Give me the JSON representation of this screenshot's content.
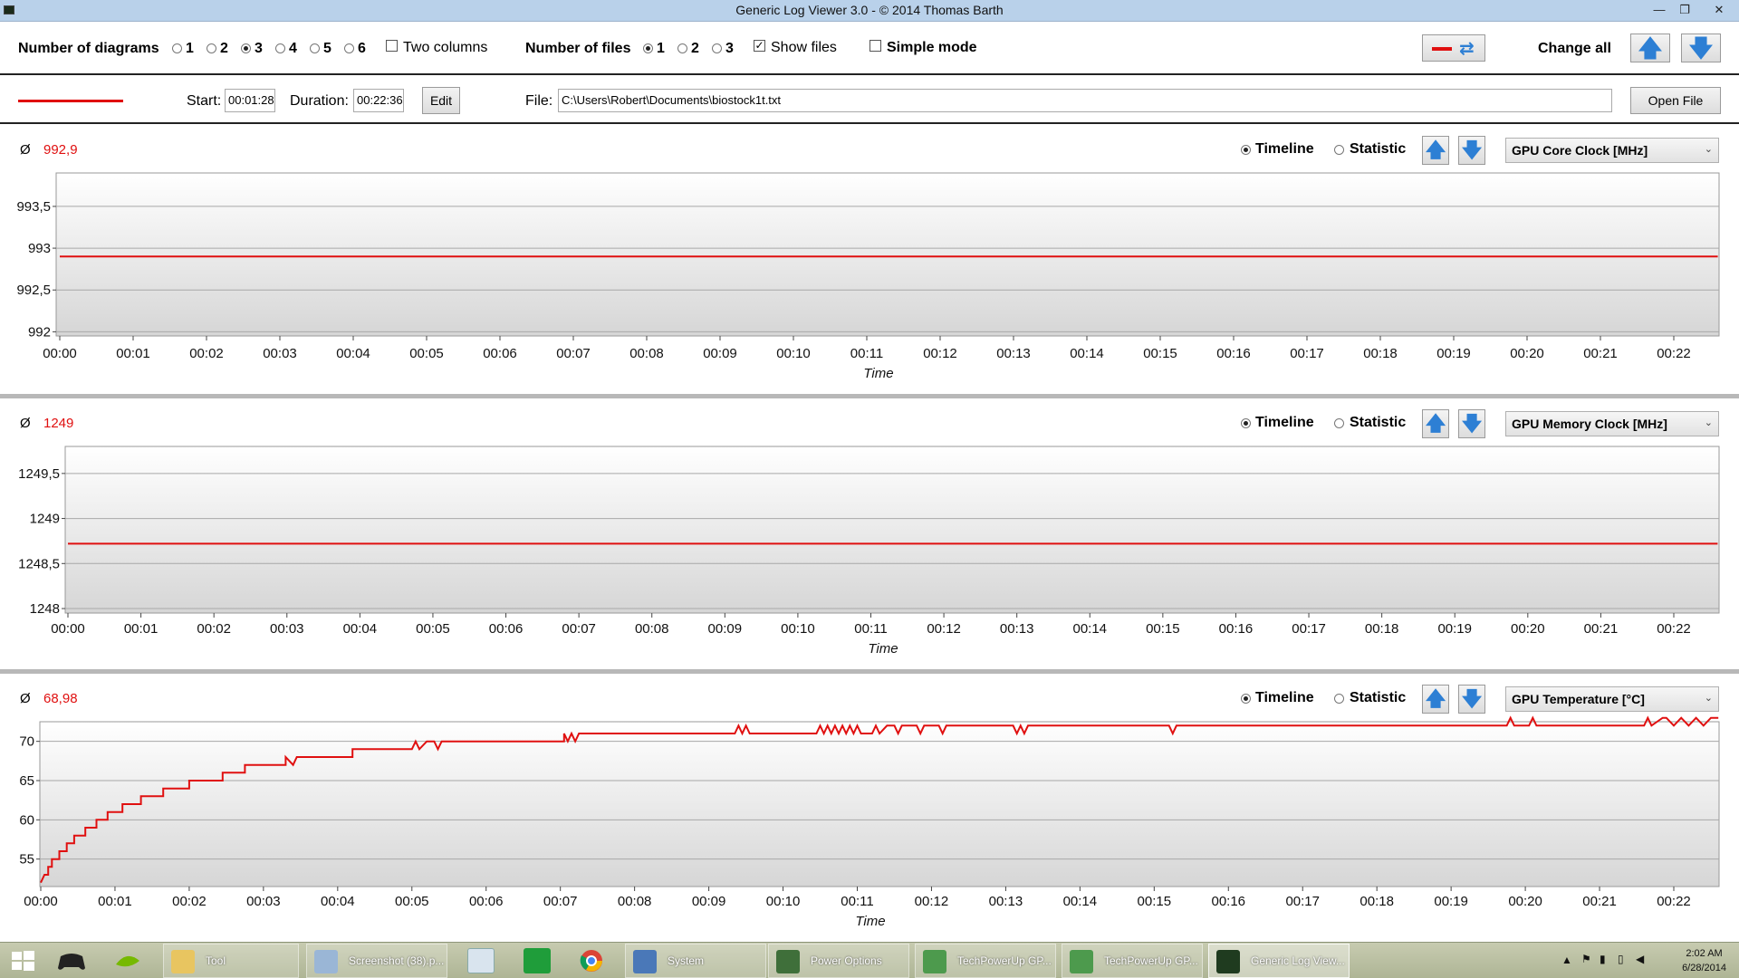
{
  "window": {
    "title": "Generic Log Viewer 3.0 - © 2014 Thomas Barth",
    "minimize": "—",
    "restore": "❐",
    "close": "✕"
  },
  "options": {
    "diagrams_label": "Number of diagrams",
    "diagram_choices": [
      "1",
      "2",
      "3",
      "4",
      "5",
      "6"
    ],
    "diagram_selected": "3",
    "two_columns_label": "Two columns",
    "two_columns_checked": false,
    "files_label": "Number of files",
    "file_choices": [
      "1",
      "2",
      "3"
    ],
    "file_selected": "1",
    "show_files_label": "Show files",
    "show_files_checked": true,
    "simple_mode_label": "Simple mode",
    "simple_mode_checked": false,
    "change_all_label": "Change all"
  },
  "file_bar": {
    "line_color": "#e01010",
    "start_label": "Start:",
    "start_value": "00:01:28",
    "duration_label": "Duration:",
    "duration_value": "00:22:36",
    "edit_label": "Edit",
    "file_label": "File:",
    "file_path": "C:\\Users\\Robert\\Documents\\biostock1t.txt",
    "open_file_label": "Open File"
  },
  "diagrams": [
    {
      "avg_symbol": "Ø",
      "avg_value": "992,9",
      "timeline_label": "Timeline",
      "statistic_label": "Statistic",
      "mode": "timeline",
      "sensor": "GPU Core Clock [MHz]"
    },
    {
      "avg_symbol": "Ø",
      "avg_value": "1249",
      "timeline_label": "Timeline",
      "statistic_label": "Statistic",
      "mode": "timeline",
      "sensor": "GPU Memory Clock [MHz]"
    },
    {
      "avg_symbol": "Ø",
      "avg_value": "68,98",
      "timeline_label": "Timeline",
      "statistic_label": "Statistic",
      "mode": "timeline",
      "sensor": "GPU Temperature [°C]"
    }
  ],
  "chart_data": [
    {
      "type": "line",
      "xlabel": "Time",
      "x_ticks": [
        "00:00",
        "00:01",
        "00:02",
        "00:03",
        "00:04",
        "00:05",
        "00:06",
        "00:07",
        "00:08",
        "00:09",
        "00:10",
        "00:11",
        "00:12",
        "00:13",
        "00:14",
        "00:15",
        "00:16",
        "00:17",
        "00:18",
        "00:19",
        "00:20",
        "00:21",
        "00:22"
      ],
      "y_ticks": [
        "993,5",
        "993",
        "992,5",
        "992"
      ],
      "ylim": [
        991.95,
        993.9
      ],
      "xlim": [
        0,
        22.6
      ],
      "series_color": "#e01010",
      "x": [
        0,
        22.6
      ],
      "y": [
        992.9,
        992.9
      ]
    },
    {
      "type": "line",
      "xlabel": "Time",
      "x_ticks": [
        "00:00",
        "00:01",
        "00:02",
        "00:03",
        "00:04",
        "00:05",
        "00:06",
        "00:07",
        "00:08",
        "00:09",
        "00:10",
        "00:11",
        "00:12",
        "00:13",
        "00:14",
        "00:15",
        "00:16",
        "00:17",
        "00:18",
        "00:19",
        "00:20",
        "00:21",
        "00:22"
      ],
      "y_ticks": [
        "1249,5",
        "1249",
        "1248,5",
        "1248"
      ],
      "ylim": [
        1247.95,
        1249.8
      ],
      "xlim": [
        0,
        22.6
      ],
      "series_color": "#e01010",
      "x": [
        0,
        22.6
      ],
      "y": [
        1248.72,
        1248.72
      ]
    },
    {
      "type": "line",
      "xlabel": "Time",
      "x_ticks": [
        "00:00",
        "00:01",
        "00:02",
        "00:03",
        "00:04",
        "00:05",
        "00:06",
        "00:07",
        "00:08",
        "00:09",
        "00:10",
        "00:11",
        "00:12",
        "00:13",
        "00:14",
        "00:15",
        "00:16",
        "00:17",
        "00:18",
        "00:19",
        "00:20",
        "00:21",
        "00:22"
      ],
      "y_ticks": [
        "70",
        "65",
        "60",
        "55"
      ],
      "ylim": [
        51.5,
        72.5
      ],
      "xlim": [
        0,
        22.6
      ],
      "series_color": "#e01010",
      "x": [
        0,
        0.05,
        0.1,
        0.1,
        0.15,
        0.15,
        0.25,
        0.25,
        0.35,
        0.35,
        0.45,
        0.45,
        0.6,
        0.6,
        0.75,
        0.75,
        0.9,
        0.9,
        1.1,
        1.1,
        1.35,
        1.35,
        1.65,
        1.65,
        2.0,
        2.0,
        2.45,
        2.45,
        2.75,
        2.75,
        3.3,
        3.3,
        3.4,
        3.45,
        3.5,
        4.2,
        4.2,
        5.0,
        5.05,
        5.1,
        5.2,
        5.3,
        5.35,
        5.4,
        5.45,
        5.5,
        7.05,
        7.05,
        7.1,
        7.15,
        7.2,
        7.25,
        7.3,
        9.35,
        9.4,
        9.45,
        9.5,
        9.55,
        10.45,
        10.5,
        10.55,
        10.6,
        10.65,
        10.7,
        10.75,
        10.8,
        10.85,
        10.9,
        10.95,
        11.0,
        11.05,
        11.2,
        11.25,
        11.3,
        11.4,
        11.5,
        11.55,
        11.6,
        11.7,
        11.8,
        11.85,
        11.9,
        12.1,
        12.15,
        12.2,
        12.25,
        13.1,
        13.15,
        13.2,
        13.25,
        13.3,
        15.2,
        15.25,
        15.3,
        19.75,
        19.8,
        19.85,
        20.05,
        20.1,
        20.15,
        21.6,
        21.65,
        21.7,
        21.85,
        21.9,
        22.0,
        22.1,
        22.2,
        22.3,
        22.4,
        22.5,
        22.6
      ],
      "y": [
        52,
        53,
        53,
        54,
        54,
        55,
        55,
        56,
        56,
        57,
        57,
        58,
        58,
        59,
        59,
        60,
        60,
        61,
        61,
        62,
        62,
        63,
        63,
        64,
        64,
        65,
        65,
        66,
        66,
        67,
        67,
        68,
        67,
        68,
        68,
        68,
        69,
        69,
        70,
        69,
        70,
        70,
        69,
        70,
        70,
        70,
        70,
        71,
        70,
        71,
        70,
        71,
        71,
        71,
        72,
        71,
        72,
        71,
        71,
        72,
        71,
        72,
        71,
        72,
        71,
        72,
        71,
        72,
        71,
        72,
        71,
        71,
        72,
        71,
        72,
        72,
        71,
        72,
        72,
        72,
        71,
        72,
        72,
        71,
        72,
        72,
        72,
        71,
        72,
        71,
        72,
        72,
        71,
        72,
        72,
        73,
        72,
        72,
        73,
        72,
        72,
        73,
        72,
        73,
        73,
        72,
        73,
        72,
        73,
        72,
        73,
        73
      ]
    }
  ],
  "taskbar": {
    "tasks": [
      "Tool",
      "Screenshot (38).p...",
      "System",
      "Power Options",
      "TechPowerUp GP...",
      "TechPowerUp GP...",
      "Generic Log View..."
    ],
    "clock_time": "2:02 AM",
    "clock_date": "6/28/2014"
  }
}
